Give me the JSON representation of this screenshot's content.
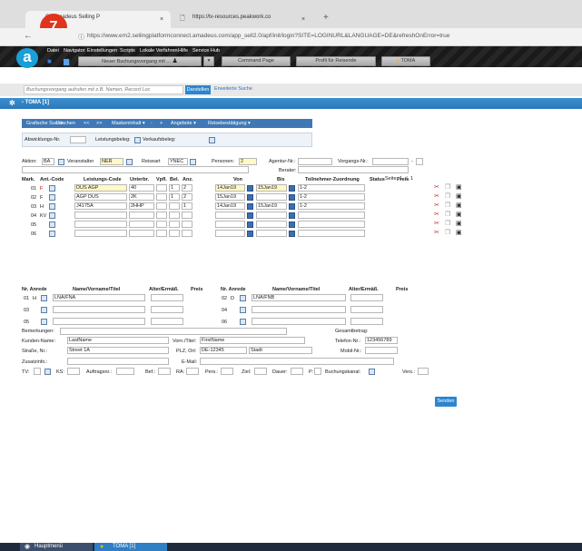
{
  "browser": {
    "tab1_title": "C - Amadeus Selling P",
    "tab2_title": "https://tv-resources.peakwork.co",
    "new_tab": "+",
    "close": "×",
    "url": "https://www.em2.sellingplatformconnect.amadeus.com/app_sell2.0/apf/init/login?SITE=LOGINURL&LANGUAGE=DE&refreshOnError=true",
    "badge_number": "7"
  },
  "app": {
    "logo_letter": "a",
    "menu": [
      "Datei",
      "Navigator",
      "Einstellungen",
      "Scripts",
      "Lokale Verfahren",
      "Hilfe",
      "Service Hub"
    ],
    "toolbar": {
      "new_booking": "Neuer Buchungsvorgang mit ...",
      "command_page": "Command Page",
      "profile": "Profil für Reisende",
      "toma": "TOMA"
    },
    "search": {
      "placeholder": "Buchungsvorgang aufrufen mit z.B. Namen, Record Loc",
      "show_button": "Darstellen",
      "advanced": "Erweiterte Suche"
    },
    "window_title": "- TOMA [1]"
  },
  "actions": [
    "Grafische Suche",
    "Löschen",
    "<<",
    ">>",
    "Maskeninhalt ▾",
    "-",
    "+",
    "Angebote ▾",
    "Reisebestätigung ▾"
  ],
  "abwicklung": {
    "nr_label": "Abwicklungs-Nr.",
    "beleg_label": "Leistungsbeleg:",
    "verkauf_label": "Verkaufsbeleg:"
  },
  "header": {
    "aktion_label": "Aktion:",
    "aktion_value": "BA",
    "veranstalter_label": "Veranstalter",
    "veranstalter_value": "NER",
    "reiseart_label": "Reiseart",
    "reiseart_value": "YNEC",
    "personen_label": "Personen:",
    "personen_value": "2",
    "agentur_label": "Agentur-Nr.:",
    "vorgangs_label": "Vorgangs-Nr.:",
    "berater_label": "Berater:",
    "seite_label": "Seite",
    "seite_value": "1",
    "seite_sep": "/",
    "seite_total": "1"
  },
  "columns": [
    "Mark.",
    "Ant.-Code",
    "Leistungs-Code",
    "Unterbr.",
    "Vpfl.",
    "Bel.",
    "Anz.",
    "Von",
    "Bis",
    "Teilnehmer-Zuordnung",
    "Status",
    "Preis"
  ],
  "rows": [
    {
      "nr": "01",
      "ant": "F",
      "code": "DUS AGP",
      "unterbr": "40",
      "vpfl": "",
      "bel": "1",
      "anz": "2",
      "von": "14Jan19",
      "bis": "15Jan19",
      "tz": "1-2"
    },
    {
      "nr": "02",
      "ant": "F",
      "code": "AGP DUS",
      "unterbr": "2K",
      "vpfl": "",
      "bel": "1",
      "anz": "2",
      "von": "15Jan19",
      "bis": "",
      "tz": "1-2"
    },
    {
      "nr": "03",
      "ant": "H",
      "code": "J4175A",
      "unterbr": "2HHP",
      "vpfl": "",
      "bel": "",
      "anz": "1",
      "von": "14Jan19",
      "bis": "15Jan19",
      "tz": "1-2"
    },
    {
      "nr": "04",
      "ant": "KV",
      "code": "",
      "unterbr": "",
      "vpfl": "",
      "bel": "",
      "anz": "",
      "von": "",
      "bis": "",
      "tz": ""
    },
    {
      "nr": "05",
      "ant": "",
      "code": "",
      "unterbr": "",
      "vpfl": "",
      "bel": "",
      "anz": "",
      "von": "",
      "bis": "",
      "tz": ""
    },
    {
      "nr": "06",
      "ant": "",
      "code": "",
      "unterbr": "",
      "vpfl": "",
      "bel": "",
      "anz": "",
      "von": "",
      "bis": "",
      "tz": ""
    }
  ],
  "persons": {
    "columns": [
      "Nr. Anrede",
      "Name/Vorname/Titel",
      "Alter/Ermäß.",
      "Preis"
    ],
    "left": [
      {
        "nr": "01",
        "anrede": "H",
        "name": "LNA/FNA"
      },
      {
        "nr": "03",
        "anrede": "",
        "name": ""
      },
      {
        "nr": "05",
        "anrede": "",
        "name": ""
      }
    ],
    "right": [
      {
        "nr": "02",
        "anrede": "D",
        "name": "LNA/FNB"
      },
      {
        "nr": "04",
        "anrede": "",
        "name": ""
      },
      {
        "nr": "06",
        "anrede": "",
        "name": ""
      }
    ]
  },
  "customer": {
    "bemerkungen_label": "Bemerkungen:",
    "gesamtbetrag_label": "Gesamtbetrag:",
    "kunden_name_label": "Kunden-Name:",
    "kunden_name_value": "LastName",
    "vorname_label": "Vorn./Titel:",
    "vorname_value": "FirstName",
    "telefon_label": "Telefon-Nr.:",
    "telefon_value": "123456789",
    "strasse_label": "Straße, Nr.:",
    "strasse_value": "Street 1A",
    "plz_label": "PLZ, Ort:",
    "plz_value": "DE-12345",
    "ort_value": "Stadt",
    "mobil_label": "Mobil-Nr.:",
    "zusatz_label": "Zusatzinfo.:",
    "email_label": "E-Mail:",
    "tv_label": "TV:",
    "ks_label": "KS:",
    "auftrag_label": "Auftragsnr.:",
    "bef_label": "Bef.:",
    "ra_label": "RA:",
    "pers_label": "Pers.:",
    "ziel_label": "Ziel:",
    "dauer_label": "Dauer:",
    "p_label": "P:",
    "kanal_label": "Buchungskanal:",
    "vers_label": "Vers.:"
  },
  "send_button": "Senden",
  "taskbar": {
    "tab1": "Hauptmenü",
    "tab2": "TOMA [1]"
  }
}
